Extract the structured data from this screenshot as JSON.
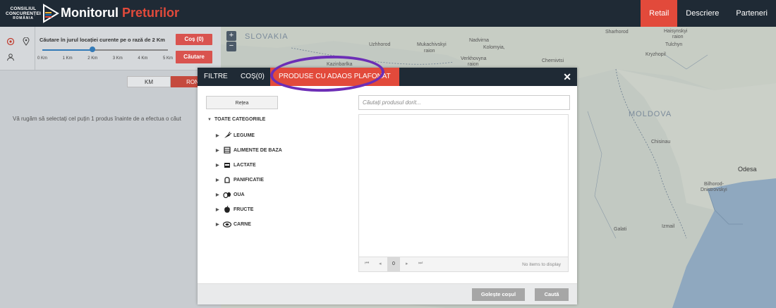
{
  "app": {
    "logo_line1": "CONSILIUL",
    "logo_line2": "CONCURENȚEI",
    "logo_line3": "ROMÂNIA",
    "title_main": "Monitorul",
    "title_accent": "Preturilor"
  },
  "nav": [
    {
      "label": "Retail",
      "active": true
    },
    {
      "label": "Descriere",
      "active": false
    },
    {
      "label": "Parteneri",
      "active": false
    }
  ],
  "search_panel": {
    "radius_label": "Căutare în jurul locației curente pe o rază de 2 Km",
    "slider_value_km": 2,
    "slider_max_km": 5,
    "ticks": [
      "0 Km",
      "1 Km",
      "2 Km",
      "3 Km",
      "4 Km",
      "5 Km"
    ],
    "cart_button": "Coș (0)",
    "search_button": "Căutare",
    "unit_tabs": [
      "KM",
      "RON"
    ],
    "message": "Vă rugăm să selectați cel puțin 1 produs înainte de a efectua o căut"
  },
  "map": {
    "zoom_in": "+",
    "zoom_out": "−",
    "labels": {
      "slovakia": "SLOVAKIA",
      "moldova": "MOLDOVA",
      "uzhhorod": "Uzhhorod",
      "mukachivskyi": "Mukachivskyi",
      "mukachivskyi_r": "raion",
      "nadvirna": "Nadvirna",
      "kolomyia": "Kolomyia,",
      "verkhovyna": "Verkhovyna",
      "verkhovyna_r": "raion",
      "chernivtsi": "Chernivtsi",
      "sharhorod": "Sharhorod",
      "haisynskyi": "Haisynskyi",
      "raion_a": "raion",
      "tulchyn": "Tulchyn",
      "kryzhopil": "Kryzhopil",
      "chisinau": "Chisinau",
      "bilhorod": "Bilhorod-",
      "dnistrovskyi": "Dnistrovskyi",
      "odesa": "Odesa",
      "galati": "Galati",
      "izmail": "Izmail",
      "karlinhadia": "Kazinbarlka"
    }
  },
  "modal": {
    "tabs": [
      {
        "label": "FILTRE",
        "active": false
      },
      {
        "label": "COȘ(0)",
        "active": false
      },
      {
        "label": "PRODUSE CU ADAOS PLAFONAT",
        "active": true
      }
    ],
    "network_button": "Rețea",
    "tree_root": "TOATE CATEGORIILE",
    "categories": [
      {
        "label": "LEGUME",
        "icon": "vegetable-icon"
      },
      {
        "label": "ALIMENTE DE BAZA",
        "icon": "basic-food-icon"
      },
      {
        "label": "LACTATE",
        "icon": "dairy-icon"
      },
      {
        "label": "PANIFICATIE",
        "icon": "bread-icon"
      },
      {
        "label": "OUA",
        "icon": "eggs-icon"
      },
      {
        "label": "FRUCTE",
        "icon": "fruit-icon"
      },
      {
        "label": "CARNE",
        "icon": "meat-icon"
      }
    ],
    "search_placeholder": "Căutați produsul dorit...",
    "pager_page": "0",
    "pager_info": "No items to display",
    "empty_cart_button": "Golește coșul",
    "search_button": "Caută"
  },
  "colors": {
    "topbar": "#1f2a35",
    "accent_red": "#e24a3b",
    "highlight": "#6c2eb6"
  }
}
